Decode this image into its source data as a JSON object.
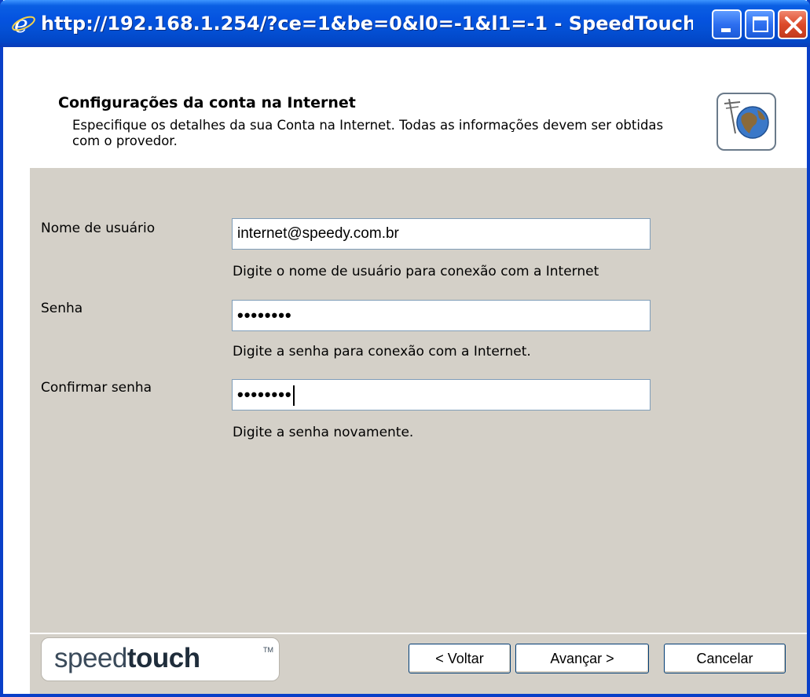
{
  "window": {
    "title": "http://192.168.1.254/?ce=1&be=0&l0=-1&l1=-1 - SpeedTouch ...",
    "icons": {
      "app": "ie-e-icon",
      "minimize": "minimize-icon",
      "maximize": "maximize-icon",
      "close": "close-icon"
    }
  },
  "header": {
    "title": "Configurações da conta na Internet",
    "description": "Especifique os detalhes da sua Conta na Internet. Todas as informações devem ser obtidas com o provedor.",
    "icon": "internet-globe-icon"
  },
  "form": {
    "username": {
      "label": "Nome de usuário",
      "value": "internet@speedy.com.br",
      "hint": "Digite o nome de usuário para conexão com a Internet"
    },
    "password": {
      "label": "Senha",
      "value": "••••••••",
      "hint": "Digite a senha para conexão com a Internet."
    },
    "confirm": {
      "label": "Confirmar senha",
      "value": "••••••••",
      "hint": "Digite a senha novamente."
    }
  },
  "footer": {
    "logo_regular": "speed",
    "logo_bold": "touch",
    "logo_tm": "TM",
    "back_label": "< Voltar",
    "next_label": "Avançar >",
    "cancel_label": "Cancelar"
  },
  "colors": {
    "titlebar": "#0553e0",
    "panel": "#d4d0c8",
    "input_border": "#7f9db9",
    "button_border": "#003c74"
  }
}
